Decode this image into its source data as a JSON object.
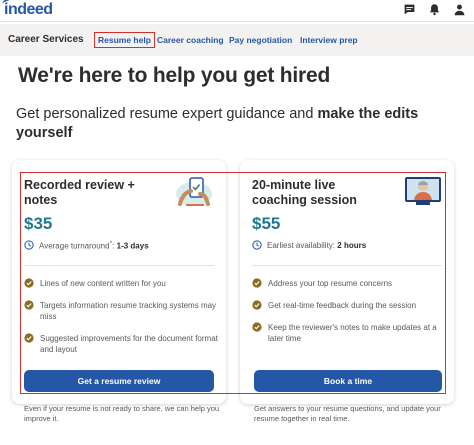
{
  "header": {
    "logo": "indeed",
    "icons": [
      "message-icon",
      "bell-icon",
      "user-icon"
    ]
  },
  "subnav": {
    "section_title": "Career Services",
    "tabs": [
      {
        "label": "Resume help",
        "active": true
      },
      {
        "label": "Career coaching",
        "active": false
      },
      {
        "label": "Pay negotiation",
        "active": false
      },
      {
        "label": "Interview prep",
        "active": false
      }
    ]
  },
  "hero": {
    "title": "We're here to help you get hired",
    "subtitle_plain": "Get personalized resume expert guidance and ",
    "subtitle_bold": "make the edits yourself"
  },
  "cards": [
    {
      "title": "Recorded review + notes",
      "price": "$35",
      "meta_label": "Average turnaround",
      "meta_sup": "*",
      "meta_value": "1-3 days",
      "features": [
        "Lines of new content written for you",
        "Targets information resume tracking systems may miss",
        "Suggested improvements for the document format and layout"
      ],
      "cta": "Get a resume review",
      "footnote": "Even if your resume is not ready to share, we can help you improve it."
    },
    {
      "title": "20-minute live coaching session",
      "price": "$55",
      "meta_label": "Earliest availability:",
      "meta_value": "2 hours",
      "features": [
        "Address your top resume concerns",
        "Get real-time feedback during the session",
        "Keep the reviewer's notes to make updates at a later time"
      ],
      "cta": "Book a time",
      "footnote": "Get answers to your resume questions, and update your resume together in real time."
    }
  ],
  "colors": {
    "brand": "#2557a7",
    "price": "#1f7a8c",
    "check": "#8a6d1e",
    "highlight": "#d32f2f"
  }
}
